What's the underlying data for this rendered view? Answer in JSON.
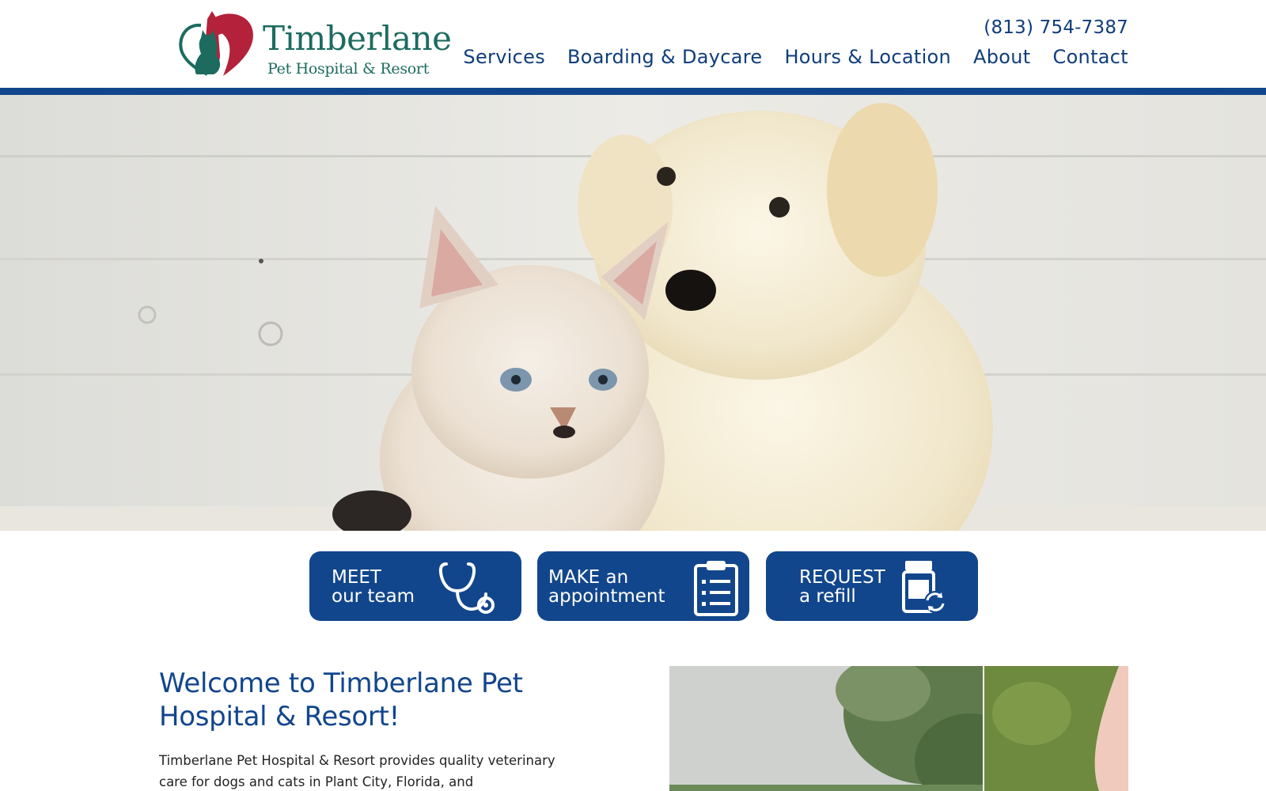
{
  "brand": {
    "name": "Timberlane",
    "subtitle": "Pet Hospital & Resort",
    "logo_icon": "heart-dog-cat-icon"
  },
  "header": {
    "phone": "(813) 754-7387",
    "nav": [
      {
        "label": "Services"
      },
      {
        "label": "Boarding & Daycare"
      },
      {
        "label": "Hours & Location"
      },
      {
        "label": "About"
      },
      {
        "label": "Contact"
      }
    ]
  },
  "hero": {
    "image": "kitten-and-puppy-photo"
  },
  "cta": [
    {
      "line1": "MEET",
      "line2": "our team",
      "icon": "stethoscope-icon"
    },
    {
      "line1": "MAKE an",
      "line2": "appointment",
      "icon": "clipboard-icon"
    },
    {
      "line1": "REQUEST",
      "line2": "a refill",
      "icon": "medicine-refill-icon"
    }
  ],
  "welcome": {
    "title": "Welcome to Timberlane Pet Hospital & Resort!",
    "text": "Timberlane Pet Hospital & Resort provides quality veterinary care for dogs and cats in Plant City, Florida, and"
  },
  "colors": {
    "brand_blue": "#12468c",
    "nav_text": "#0f3d7a",
    "logo_green": "#1d6b5f",
    "logo_red": "#b3213a"
  }
}
